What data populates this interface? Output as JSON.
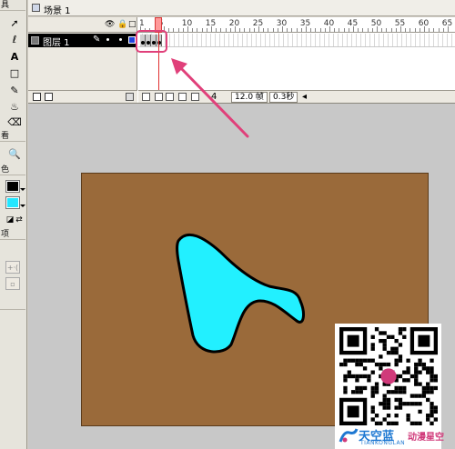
{
  "title_bar": {
    "scene_label": "场景 1"
  },
  "tools_panel": {
    "top_label": "具",
    "view_label": "看",
    "color_label": "色",
    "options_label": "项"
  },
  "timeline": {
    "layer_name": "图层 1",
    "ruler_numbers": [
      "1",
      "5",
      "10",
      "15",
      "20",
      "25",
      "30",
      "35",
      "40",
      "45",
      "50",
      "55",
      "60",
      "65"
    ],
    "current_frame": "4",
    "frame_rate": "12.0 帧",
    "elapsed_time": "0.3秒"
  },
  "stage": {
    "background_color": "#9a6a3a",
    "shape_fill": "#22f0ff",
    "shape_stroke": "#000000"
  },
  "annotation": {
    "highlight_color": "#e0407a"
  },
  "watermark": {
    "brand_cn": "天空蓝",
    "brand_en": "TIANKONGLAN",
    "brand_sub": "动漫星空"
  }
}
